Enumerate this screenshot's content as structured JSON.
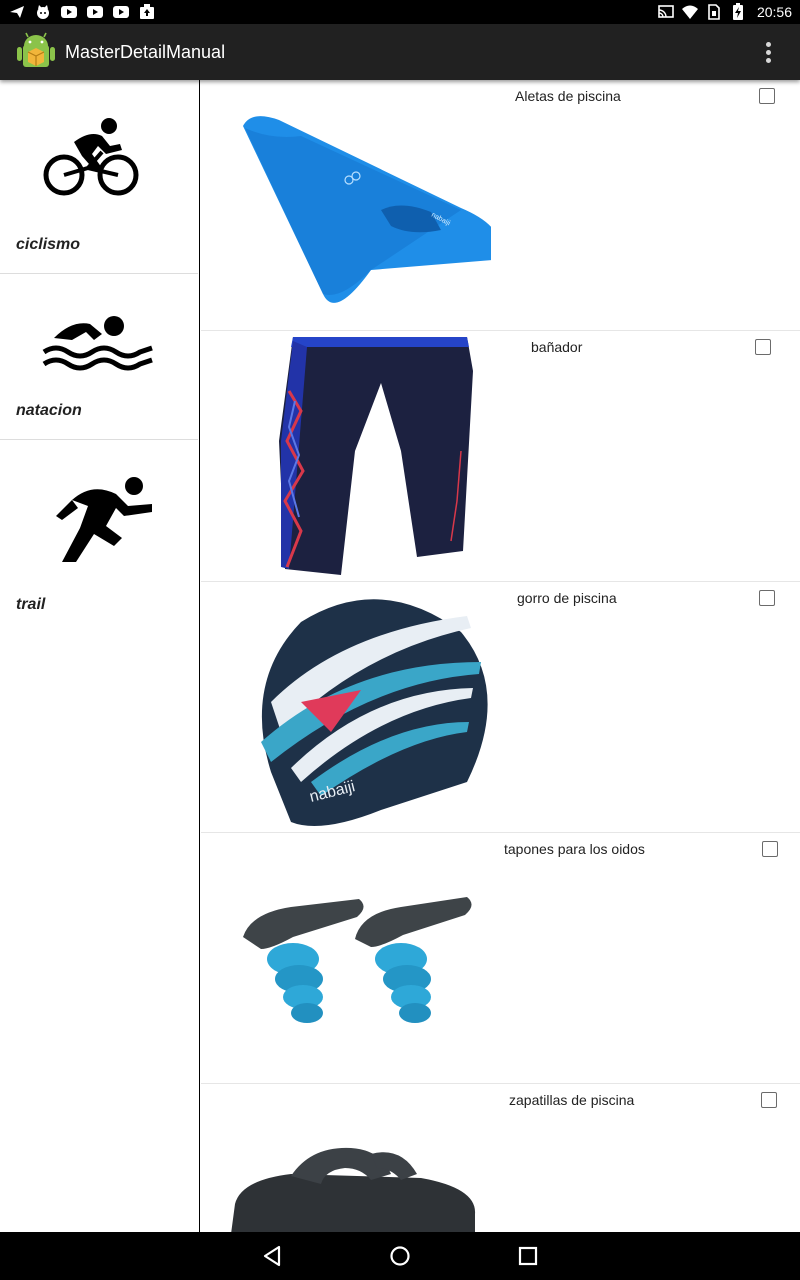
{
  "status_bar": {
    "time": "20:56",
    "left_icons": [
      "send-icon",
      "android-cat-icon",
      "youtube-icon",
      "youtube-icon",
      "youtube-icon",
      "upload-icon"
    ],
    "right_icons": [
      "cast-icon",
      "wifi-icon",
      "sim-icon",
      "battery-charging-icon"
    ]
  },
  "app_bar": {
    "title": "MasterDetailManual",
    "menu_icon": "overflow-menu-icon"
  },
  "master": {
    "items": [
      {
        "label": "ciclismo",
        "icon": "cycling-icon"
      },
      {
        "label": "natacion",
        "icon": "swimming-icon"
      },
      {
        "label": "trail",
        "icon": "running-icon"
      }
    ]
  },
  "detail": {
    "products": [
      {
        "name": "Aletas de piscina",
        "checked": false,
        "image": "swim-fin"
      },
      {
        "name": "bañador",
        "checked": false,
        "image": "swim-shorts"
      },
      {
        "name": "gorro de piscina",
        "checked": false,
        "image": "swim-cap"
      },
      {
        "name": "tapones para los oidos",
        "checked": false,
        "image": "ear-plugs"
      },
      {
        "name": "zapatillas de piscina",
        "checked": false,
        "image": "pool-sandal"
      }
    ]
  },
  "nav_bar": {
    "buttons": [
      "back-icon",
      "home-icon",
      "recents-icon"
    ]
  }
}
